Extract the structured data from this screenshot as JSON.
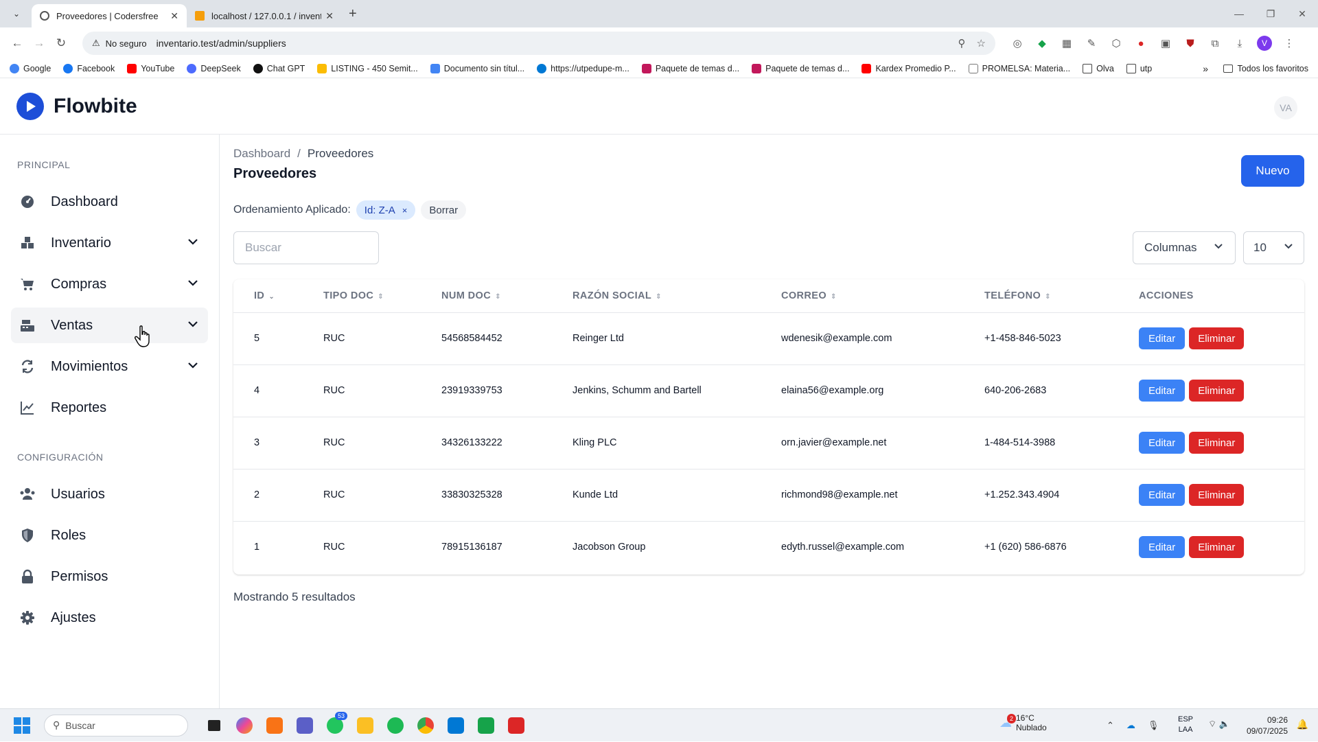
{
  "browser": {
    "tabs": [
      {
        "title": "Proveedores | Codersfree",
        "active": true
      },
      {
        "title": "localhost / 127.0.0.1 / inventari",
        "active": false
      }
    ],
    "security_label": "No seguro",
    "url": "inventario.test/admin/suppliers",
    "bookmarks": [
      "Google",
      "Facebook",
      "YouTube",
      "DeepSeek",
      "Chat GPT",
      "LISTING - 450 Semit...",
      "Documento sin títul...",
      "https://utpedupe-m...",
      "Paquete de temas d...",
      "Paquete de temas d...",
      "Kardex Promedio P...",
      "PROMELSA: Materia...",
      "Olva",
      "utp"
    ],
    "all_bookmarks": "Todos los favoritos",
    "profile_initial": "V"
  },
  "app": {
    "brand": "Flowbite",
    "avatar_initials": "VA"
  },
  "sidebar": {
    "section_principal": "PRINCIPAL",
    "section_config": "CONFIGURACIÓN",
    "principal_items": [
      {
        "label": "Dashboard",
        "icon": "dashboard-icon",
        "has_chevron": false
      },
      {
        "label": "Inventario",
        "icon": "inventory-icon",
        "has_chevron": true
      },
      {
        "label": "Compras",
        "icon": "cart-icon",
        "has_chevron": true
      },
      {
        "label": "Ventas",
        "icon": "register-icon",
        "has_chevron": true
      },
      {
        "label": "Movimientos",
        "icon": "arrows-icon",
        "has_chevron": true
      },
      {
        "label": "Reportes",
        "icon": "chart-line-icon",
        "has_chevron": false
      }
    ],
    "config_items": [
      {
        "label": "Usuarios",
        "icon": "users-icon"
      },
      {
        "label": "Roles",
        "icon": "shield-icon"
      },
      {
        "label": "Permisos",
        "icon": "lock-icon"
      },
      {
        "label": "Ajustes",
        "icon": "gear-icon"
      }
    ]
  },
  "page": {
    "breadcrumb_root": "Dashboard",
    "breadcrumb_sep": "/",
    "breadcrumb_current": "Proveedores",
    "title": "Proveedores",
    "new_button": "Nuevo",
    "sort_label": "Ordenamiento Aplicado:",
    "sort_chip": "Id: Z-A",
    "sort_chip_remove": "×",
    "sort_clear": "Borrar",
    "search_placeholder": "Buscar",
    "columns_button": "Columnas",
    "per_page": "10",
    "results_text": "Mostrando 5 resultados"
  },
  "table": {
    "headers": [
      "ID",
      "TIPO DOC",
      "NUM DOC",
      "RAZÓN SOCIAL",
      "CORREO",
      "TELÉFONO",
      "ACCIONES"
    ],
    "edit_label": "Editar",
    "delete_label": "Eliminar",
    "rows": [
      {
        "id": "5",
        "tipo": "RUC",
        "num": "54568584452",
        "razon": "Reinger Ltd",
        "correo": "wdenesik@example.com",
        "telefono": "+1-458-846-5023"
      },
      {
        "id": "4",
        "tipo": "RUC",
        "num": "23919339753",
        "razon": "Jenkins, Schumm and Bartell",
        "correo": "elaina56@example.org",
        "telefono": "640-206-2683"
      },
      {
        "id": "3",
        "tipo": "RUC",
        "num": "34326133222",
        "razon": "Kling PLC",
        "correo": "orn.javier@example.net",
        "telefono": "1-484-514-3988"
      },
      {
        "id": "2",
        "tipo": "RUC",
        "num": "33830325328",
        "razon": "Kunde Ltd",
        "correo": "richmond98@example.net",
        "telefono": "+1.252.343.4904"
      },
      {
        "id": "1",
        "tipo": "RUC",
        "num": "78915136187",
        "razon": "Jacobson Group",
        "correo": "edyth.russel@example.com",
        "telefono": "+1 (620) 586-6876"
      }
    ]
  },
  "taskbar": {
    "search_placeholder": "Buscar",
    "whatsapp_badge": "53",
    "weather_temp": "16°C",
    "weather_desc": "Nublado",
    "weather_badge": "2",
    "lang_line1": "ESP",
    "lang_line2": "LAA",
    "time": "09:26",
    "date": "09/07/2025"
  },
  "colors": {
    "primary": "#2563eb",
    "danger": "#dc2626",
    "edit": "#3b82f6"
  }
}
